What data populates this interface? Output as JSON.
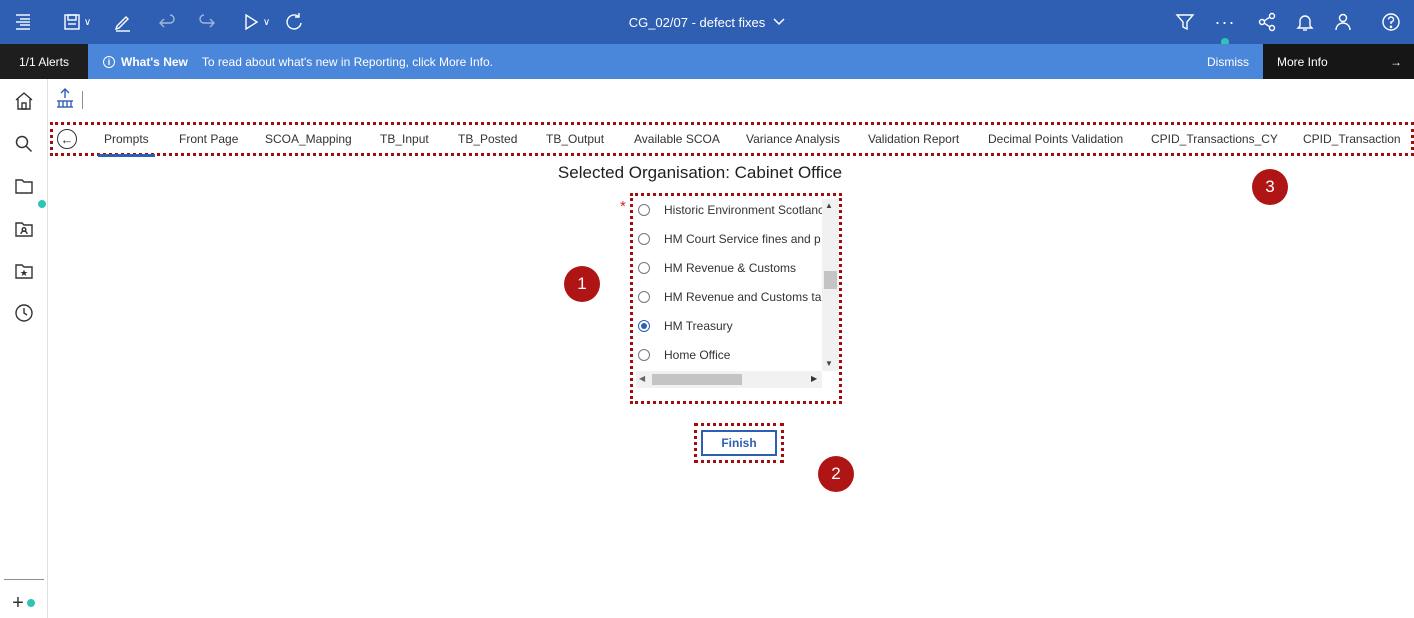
{
  "toolbar": {
    "document_title": "CG_02/07 - defect fixes",
    "caret": "∨"
  },
  "alerts": {
    "count_label": "1/1 Alerts",
    "info_glyph": "i",
    "headline": "What's New",
    "message": "To read about what's new in Reporting, click More Info.",
    "dismiss_label": "Dismiss",
    "more_info_label": "More Info",
    "arrow": "→"
  },
  "tabs": [
    {
      "label": "Prompts",
      "active": true
    },
    {
      "label": "Front Page"
    },
    {
      "label": "SCOA_Mapping"
    },
    {
      "label": "TB_Input"
    },
    {
      "label": "TB_Posted"
    },
    {
      "label": "TB_Output"
    },
    {
      "label": "Available SCOA"
    },
    {
      "label": "Variance Analysis"
    },
    {
      "label": "Validation Report"
    },
    {
      "label": "Decimal Points Validation"
    },
    {
      "label": "CPID_Transactions_CY"
    },
    {
      "label": "CPID_Transaction"
    }
  ],
  "main": {
    "title": "Selected Organisation: Cabinet Office",
    "required_marker": "*",
    "options": [
      {
        "label": "Historic Environment Scotlanc",
        "checked": false
      },
      {
        "label": "HM Court Service fines and p",
        "checked": false
      },
      {
        "label": "HM Revenue & Customs",
        "checked": false
      },
      {
        "label": "HM Revenue and Customs ta:",
        "checked": false
      },
      {
        "label": "HM Treasury",
        "checked": true
      },
      {
        "label": "Home Office",
        "checked": false
      }
    ],
    "finish_label": "Finish"
  },
  "callouts": [
    "1",
    "2",
    "3"
  ],
  "leftnav": {
    "add_label": "+"
  },
  "colors": {
    "toolbar": "#2f5fb3",
    "alertbar": "#4a86d9",
    "callout": "#b01515",
    "annotation_border": "#a10d0d"
  }
}
